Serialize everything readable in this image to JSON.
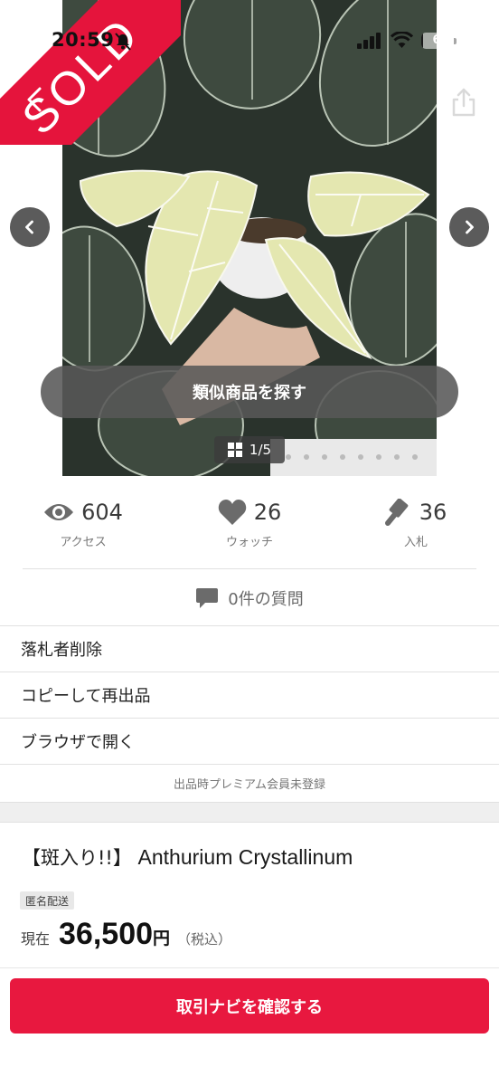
{
  "status_bar": {
    "time": "20:59",
    "battery": "6",
    "battery_level": 0.06
  },
  "listing": {
    "sold_label": "SOLD",
    "similar_button_label": "類似商品を探す",
    "image_counter": "1/5"
  },
  "stats": {
    "access": {
      "value": "604",
      "label": "アクセス",
      "icon": "eye-icon"
    },
    "watch": {
      "value": "26",
      "label": "ウォッチ",
      "icon": "heart-icon"
    },
    "bids": {
      "value": "36",
      "label": "入札",
      "icon": "gavel-icon"
    }
  },
  "questions": {
    "label": "0件の質問",
    "icon": "comment-icon"
  },
  "menu": {
    "items": [
      {
        "label": "落札者削除"
      },
      {
        "label": "コピーして再出品"
      },
      {
        "label": "ブラウザで開く"
      }
    ],
    "note": "出品時プレミアム会員未登録"
  },
  "item": {
    "title_prefix": "【斑入り!!】",
    "title_name": "Anthurium Crystallinum",
    "shipping_badge": "匿名配送",
    "price_label": "現在",
    "price_value": "36,500",
    "price_currency": "円",
    "price_tax": "（税込）"
  },
  "cta": {
    "label": "取引ナビを確認する"
  },
  "colors": {
    "accent": "#e8183f",
    "sold_ribbon": "#e5143c"
  }
}
